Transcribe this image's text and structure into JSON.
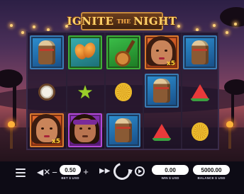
{
  "title": {
    "main_1": "IGNITE",
    "small": "THE",
    "main_2": "NIGHT"
  },
  "reels": [
    [
      "drum",
      "coconut",
      "queen-x5"
    ],
    [
      "maracas",
      "star-fruit",
      "rocker"
    ],
    [
      "guitar",
      "pineapple",
      "drum"
    ],
    [
      "queen-x5",
      "drum",
      "watermelon"
    ],
    [
      "drum",
      "watermelon",
      "pineapple"
    ]
  ],
  "multipliers": {
    "queen": "x5"
  },
  "controls": {
    "bet_value": "0.50",
    "bet_caption": "BET $ USD",
    "win_value": "0.00",
    "win_caption": "WIN $ USD",
    "balance_value": "5000.00",
    "balance_caption": "BALANCE $ USD",
    "minus": "−",
    "plus": "+"
  },
  "icons": [
    "menu-icon",
    "sound-icon",
    "turbo-icon",
    "spin-icon",
    "autoplay-icon"
  ],
  "colors": {
    "accent_gold": "#ffd36b",
    "reel_frame_blue": "#3a7bb4",
    "bar_bg": "#0d0b15"
  }
}
